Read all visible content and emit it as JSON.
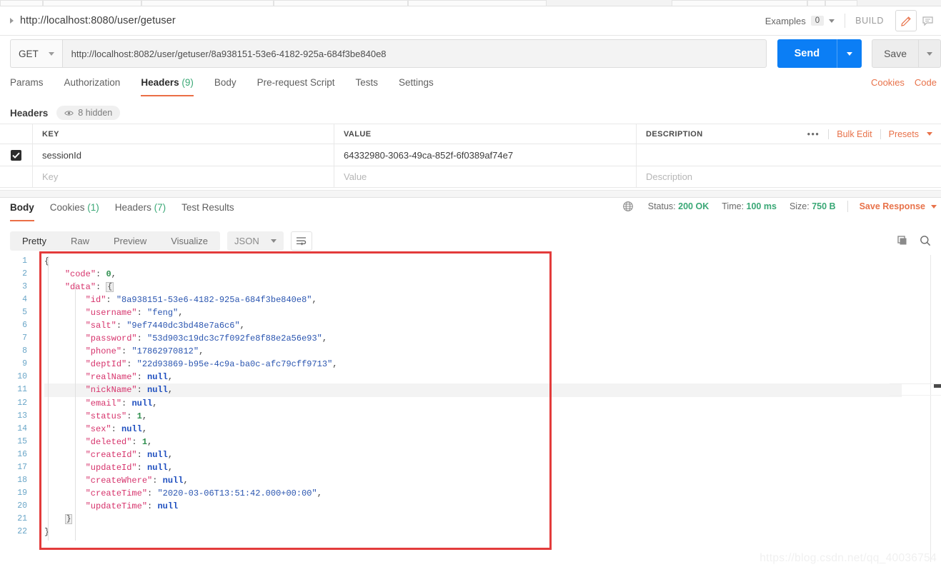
{
  "window": {
    "request_title": "http://localhost:8080/user/getuser",
    "examples_label": "Examples",
    "examples_count": "0",
    "build_label": "BUILD",
    "edit_icon": "pencil-icon",
    "comment_icon": "comment-icon"
  },
  "url_bar": {
    "method": "GET",
    "url": "http://localhost:8082/user/getuser/8a938151-53e6-4182-925a-684f3be840e8",
    "send_label": "Send",
    "save_label": "Save"
  },
  "request_tabs": {
    "items": [
      {
        "label": "Params",
        "count": "",
        "selected": false
      },
      {
        "label": "Authorization",
        "count": "",
        "selected": false
      },
      {
        "label": "Headers",
        "count": "(9)",
        "selected": true
      },
      {
        "label": "Body",
        "count": "",
        "selected": false
      },
      {
        "label": "Pre-request Script",
        "count": "",
        "selected": false
      },
      {
        "label": "Tests",
        "count": "",
        "selected": false
      },
      {
        "label": "Settings",
        "count": "",
        "selected": false
      }
    ],
    "right_links": [
      "Cookies",
      "Code"
    ]
  },
  "headers_section": {
    "label": "Headers",
    "hidden_pill": "8 hidden",
    "eye_icon": "eye-icon",
    "columns": [
      "KEY",
      "VALUE",
      "DESCRIPTION"
    ],
    "rows": [
      {
        "checked": true,
        "key": "sessionId",
        "value": "64332980-3063-49ca-852f-6f0389af74e7",
        "description": ""
      }
    ],
    "placeholder_row": {
      "key": "Key",
      "value": "Value",
      "description": "Description"
    },
    "actions": {
      "more": "•••",
      "bulk_edit": "Bulk Edit",
      "presets": "Presets"
    }
  },
  "response": {
    "tabs": [
      {
        "label": "Body",
        "count": "",
        "selected": true
      },
      {
        "label": "Cookies",
        "count": "(1)",
        "selected": false
      },
      {
        "label": "Headers",
        "count": "(7)",
        "selected": false
      },
      {
        "label": "Test Results",
        "count": "",
        "selected": false
      }
    ],
    "meta": {
      "globe_icon": "globe-icon",
      "status_label": "Status:",
      "status_value": "200 OK",
      "time_label": "Time:",
      "time_value": "100 ms",
      "size_label": "Size:",
      "size_value": "750 B",
      "save_response": "Save Response"
    },
    "toolbar": {
      "formats": [
        "Pretty",
        "Raw",
        "Preview",
        "Visualize"
      ],
      "selected_format": "Pretty",
      "language": "JSON",
      "wrap_icon": "word-wrap-icon",
      "copy_icon": "copy-icon",
      "search_icon": "search-icon"
    },
    "body_json": {
      "line_numbers": [
        "1",
        "2",
        "3",
        "4",
        "5",
        "6",
        "7",
        "8",
        "9",
        "10",
        "11",
        "12",
        "13",
        "14",
        "15",
        "16",
        "17",
        "18",
        "19",
        "20",
        "21",
        "22"
      ],
      "lines": [
        {
          "n": 1,
          "indent": 0,
          "type": "open",
          "text": "{"
        },
        {
          "n": 2,
          "indent": 1,
          "type": "pair",
          "key": "code",
          "value": "0",
          "vtype": "number",
          "comma": true
        },
        {
          "n": 3,
          "indent": 1,
          "type": "objopen",
          "key": "data",
          "value": "{",
          "comma": false
        },
        {
          "n": 4,
          "indent": 2,
          "type": "pair",
          "key": "id",
          "value": "\"8a938151-53e6-4182-925a-684f3be840e8\"",
          "vtype": "string",
          "comma": true
        },
        {
          "n": 5,
          "indent": 2,
          "type": "pair",
          "key": "username",
          "value": "\"feng\"",
          "vtype": "string",
          "comma": true
        },
        {
          "n": 6,
          "indent": 2,
          "type": "pair",
          "key": "salt",
          "value": "\"9ef7440dc3bd48e7a6c6\"",
          "vtype": "string",
          "comma": true
        },
        {
          "n": 7,
          "indent": 2,
          "type": "pair",
          "key": "password",
          "value": "\"53d903c19dc3c7f092fe8f88e2a56e93\"",
          "vtype": "string",
          "comma": true
        },
        {
          "n": 8,
          "indent": 2,
          "type": "pair",
          "key": "phone",
          "value": "\"17862970812\"",
          "vtype": "string",
          "comma": true
        },
        {
          "n": 9,
          "indent": 2,
          "type": "pair",
          "key": "deptId",
          "value": "\"22d93869-b95e-4c9a-ba0c-afc79cff9713\"",
          "vtype": "string",
          "comma": true
        },
        {
          "n": 10,
          "indent": 2,
          "type": "pair",
          "key": "realName",
          "value": "null",
          "vtype": "null",
          "comma": true
        },
        {
          "n": 11,
          "indent": 2,
          "type": "pair",
          "key": "nickName",
          "value": "null",
          "vtype": "null",
          "comma": true,
          "highlight": true
        },
        {
          "n": 12,
          "indent": 2,
          "type": "pair",
          "key": "email",
          "value": "null",
          "vtype": "null",
          "comma": true
        },
        {
          "n": 13,
          "indent": 2,
          "type": "pair",
          "key": "status",
          "value": "1",
          "vtype": "number",
          "comma": true
        },
        {
          "n": 14,
          "indent": 2,
          "type": "pair",
          "key": "sex",
          "value": "null",
          "vtype": "null",
          "comma": true
        },
        {
          "n": 15,
          "indent": 2,
          "type": "pair",
          "key": "deleted",
          "value": "1",
          "vtype": "number",
          "comma": true
        },
        {
          "n": 16,
          "indent": 2,
          "type": "pair",
          "key": "createId",
          "value": "null",
          "vtype": "null",
          "comma": true
        },
        {
          "n": 17,
          "indent": 2,
          "type": "pair",
          "key": "updateId",
          "value": "null",
          "vtype": "null",
          "comma": true
        },
        {
          "n": 18,
          "indent": 2,
          "type": "pair",
          "key": "createWhere",
          "value": "null",
          "vtype": "null",
          "comma": true
        },
        {
          "n": 19,
          "indent": 2,
          "type": "pair",
          "key": "createTime",
          "value": "\"2020-03-06T13:51:42.000+00:00\"",
          "vtype": "string",
          "comma": true
        },
        {
          "n": 20,
          "indent": 2,
          "type": "pair",
          "key": "updateTime",
          "value": "null",
          "vtype": "null",
          "comma": false
        },
        {
          "n": 21,
          "indent": 1,
          "type": "close",
          "text": "}"
        },
        {
          "n": 22,
          "indent": 0,
          "type": "close",
          "text": "}"
        }
      ]
    }
  },
  "watermark": "https://blog.csdn.net/qq_40036754",
  "colors": {
    "accent_orange": "#eb6f46",
    "send_blue": "#0b7ef5",
    "status_green": "#3aa876",
    "annotation_red": "#e33b3b"
  }
}
